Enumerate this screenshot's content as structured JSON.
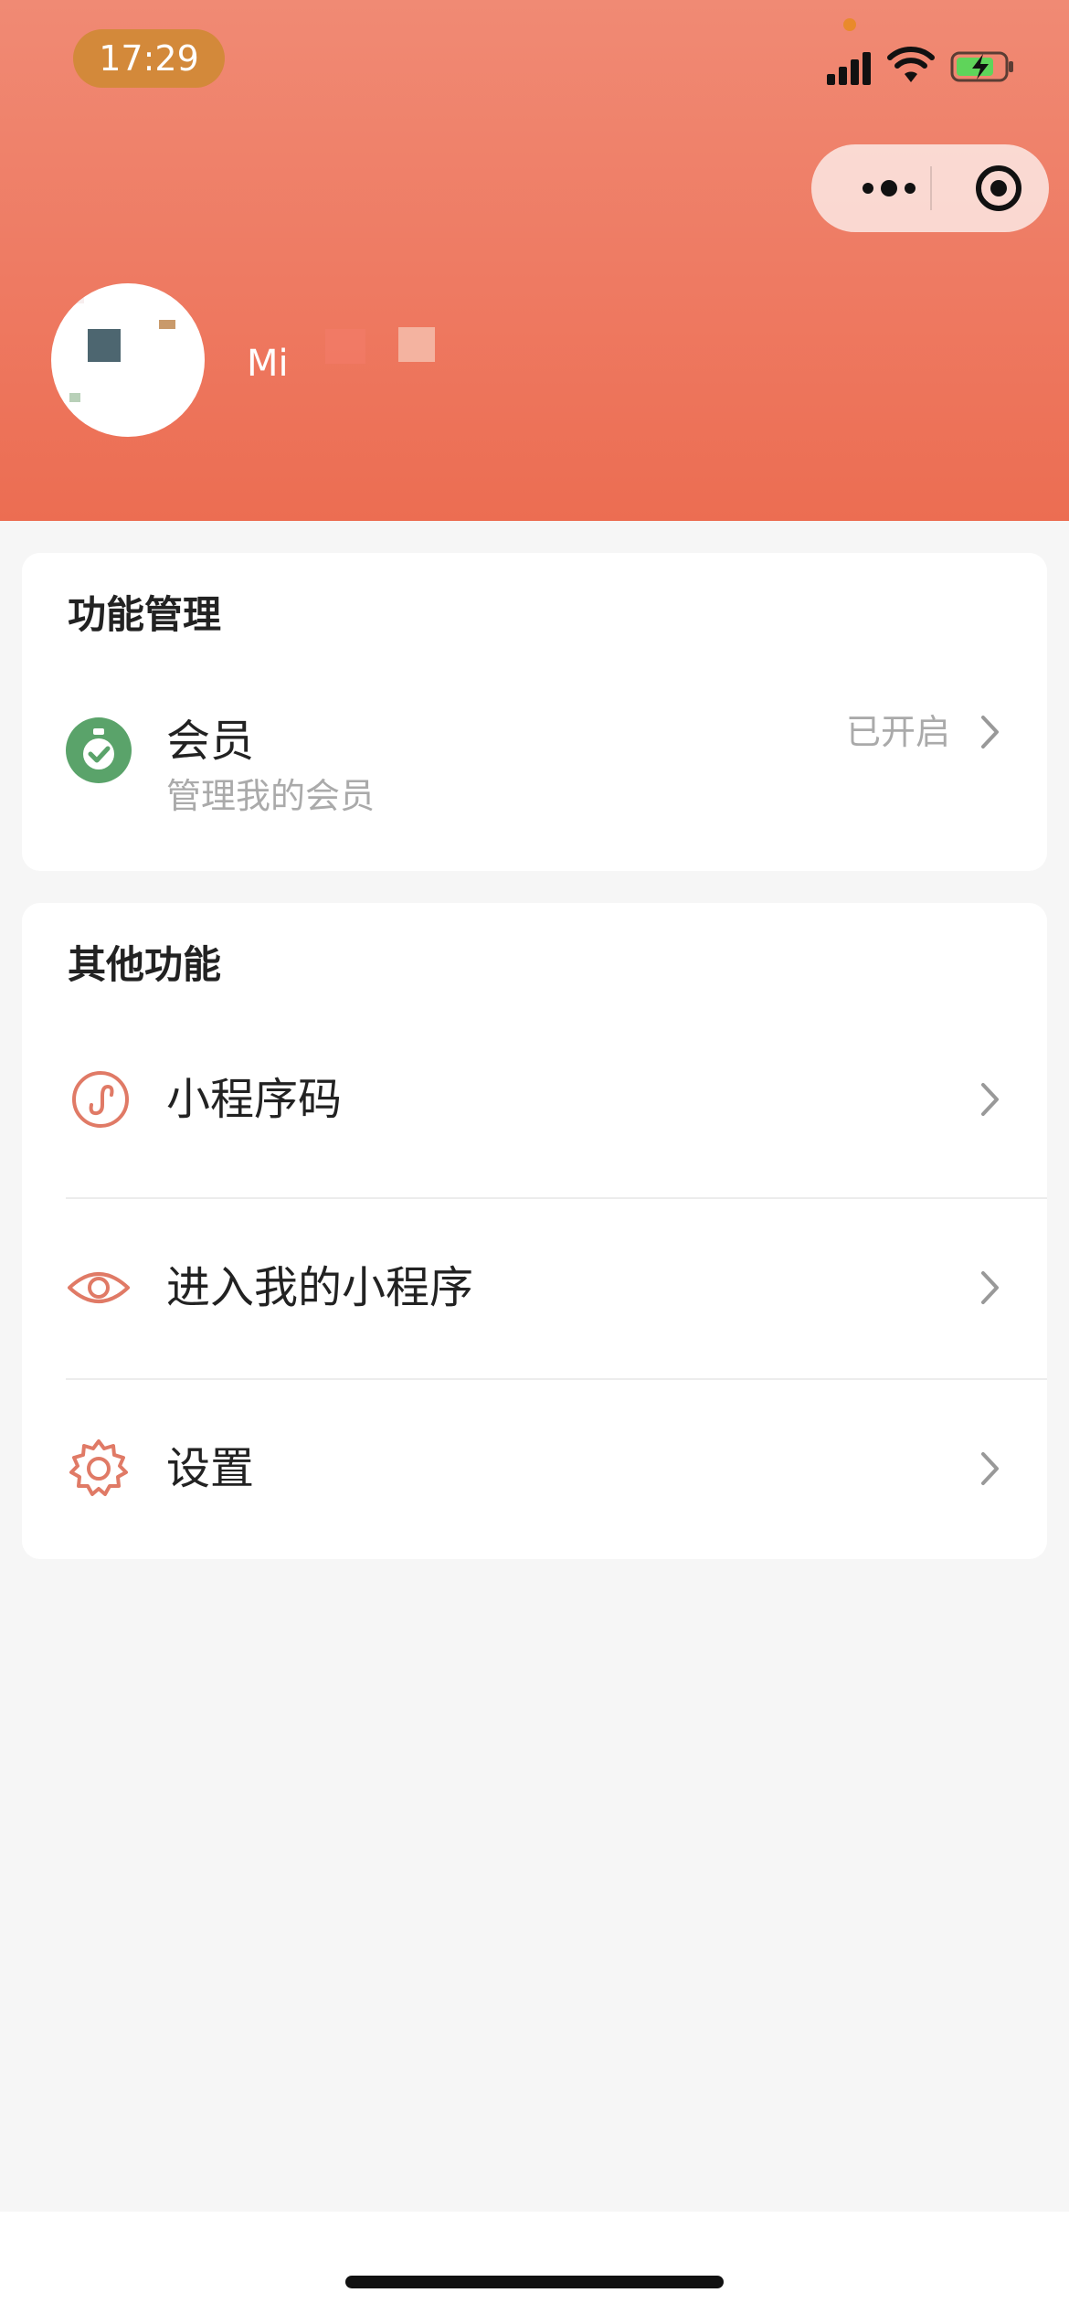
{
  "status_bar": {
    "time": "17:29"
  },
  "profile": {
    "name": "Mi"
  },
  "section_manage": {
    "title": "功能管理",
    "member": {
      "label": "会员",
      "sub": "管理我的会员",
      "status": "已开启"
    }
  },
  "section_other": {
    "title": "其他功能",
    "items": [
      {
        "label": "小程序码",
        "icon": "mini-program-icon"
      },
      {
        "label": "进入我的小程序",
        "icon": "eye-icon"
      },
      {
        "label": "设置",
        "icon": "gear-icon"
      }
    ]
  },
  "colors": {
    "header": "#ee7a62",
    "accent": "#e07a66",
    "member_icon": "#5aa36a",
    "time_pill": "#d3893a"
  }
}
